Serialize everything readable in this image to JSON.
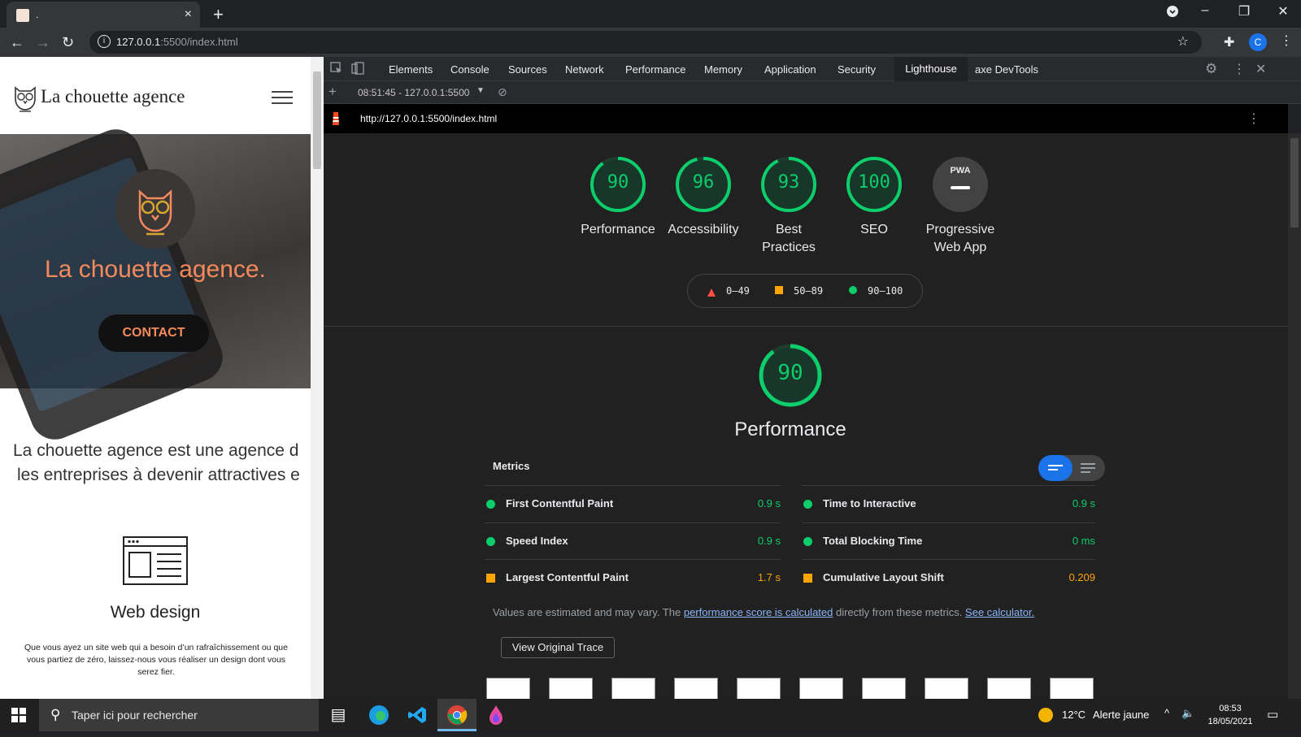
{
  "browser": {
    "tab_title": ".",
    "tab_close": "×",
    "new_tab": "+",
    "url_host": "127.0.0.1",
    "url_rest": ":5500/index.html",
    "profile_initial": "C",
    "window_controls": [
      "minimize-icon",
      "restore-icon",
      "close-icon"
    ]
  },
  "site": {
    "name": "La chouette agence",
    "hero_title": "La chouette agence.",
    "contact_label": "CONTACT",
    "intro_line1": "La chouette agence est une agence d",
    "intro_line2": "les entreprises à devenir attractives e",
    "service_title": "Web design",
    "service_text": "Que vous ayez un site web qui a besoin d’un rafraîchissement ou que vous partiez de zéro, laissez-nous vous réaliser un design dont vous serez fier."
  },
  "devtools": {
    "tabs": [
      "Elements",
      "Console",
      "Sources",
      "Network",
      "Performance",
      "Memory",
      "Application",
      "Security",
      "Lighthouse",
      "axe DevTools"
    ],
    "active_tab": "Lighthouse",
    "report_select": "08:51:45 - 127.0.0.1:5500",
    "report_url": "http://127.0.0.1:5500/index.html"
  },
  "lighthouse": {
    "scores": [
      {
        "label": "Performance",
        "value": "90",
        "fraction": 0.9
      },
      {
        "label": "Accessibility",
        "value": "96",
        "fraction": 0.96
      },
      {
        "label": "Best Practices",
        "value": "93",
        "fraction": 0.93
      },
      {
        "label": "SEO",
        "value": "100",
        "fraction": 1.0
      }
    ],
    "pwa": {
      "badge": "PWA",
      "label": "Progressive Web App"
    },
    "legend": [
      "0–49",
      "50–89",
      "90–100"
    ],
    "legend_colors": {
      "fail": "#ff4e42",
      "average": "#ffa400",
      "pass": "#0cce6b"
    },
    "section_score": "90",
    "section_fraction": 0.9,
    "section_title": "Performance",
    "metrics_title": "Metrics",
    "metrics": [
      {
        "name": "First Contentful Paint",
        "value": "0.9 s",
        "status": "pass"
      },
      {
        "name": "Time to Interactive",
        "value": "0.9 s",
        "status": "pass"
      },
      {
        "name": "Speed Index",
        "value": "0.9 s",
        "status": "pass"
      },
      {
        "name": "Total Blocking Time",
        "value": "0 ms",
        "status": "pass"
      },
      {
        "name": "Largest Contentful Paint",
        "value": "1.7 s",
        "status": "average"
      },
      {
        "name": "Cumulative Layout Shift",
        "value": "0.209",
        "status": "average"
      }
    ],
    "note_prefix": "Values are estimated and may vary. The ",
    "note_link1": "performance score is calculated",
    "note_middle": " directly from these metrics. ",
    "note_link2": "See calculator.",
    "trace_button": "View Original Trace"
  },
  "taskbar": {
    "search_placeholder": "Taper ici pour rechercher",
    "weather_temp": "12°C",
    "weather_alert": "Alerte jaune",
    "time": "08:53",
    "date": "18/05/2021"
  }
}
